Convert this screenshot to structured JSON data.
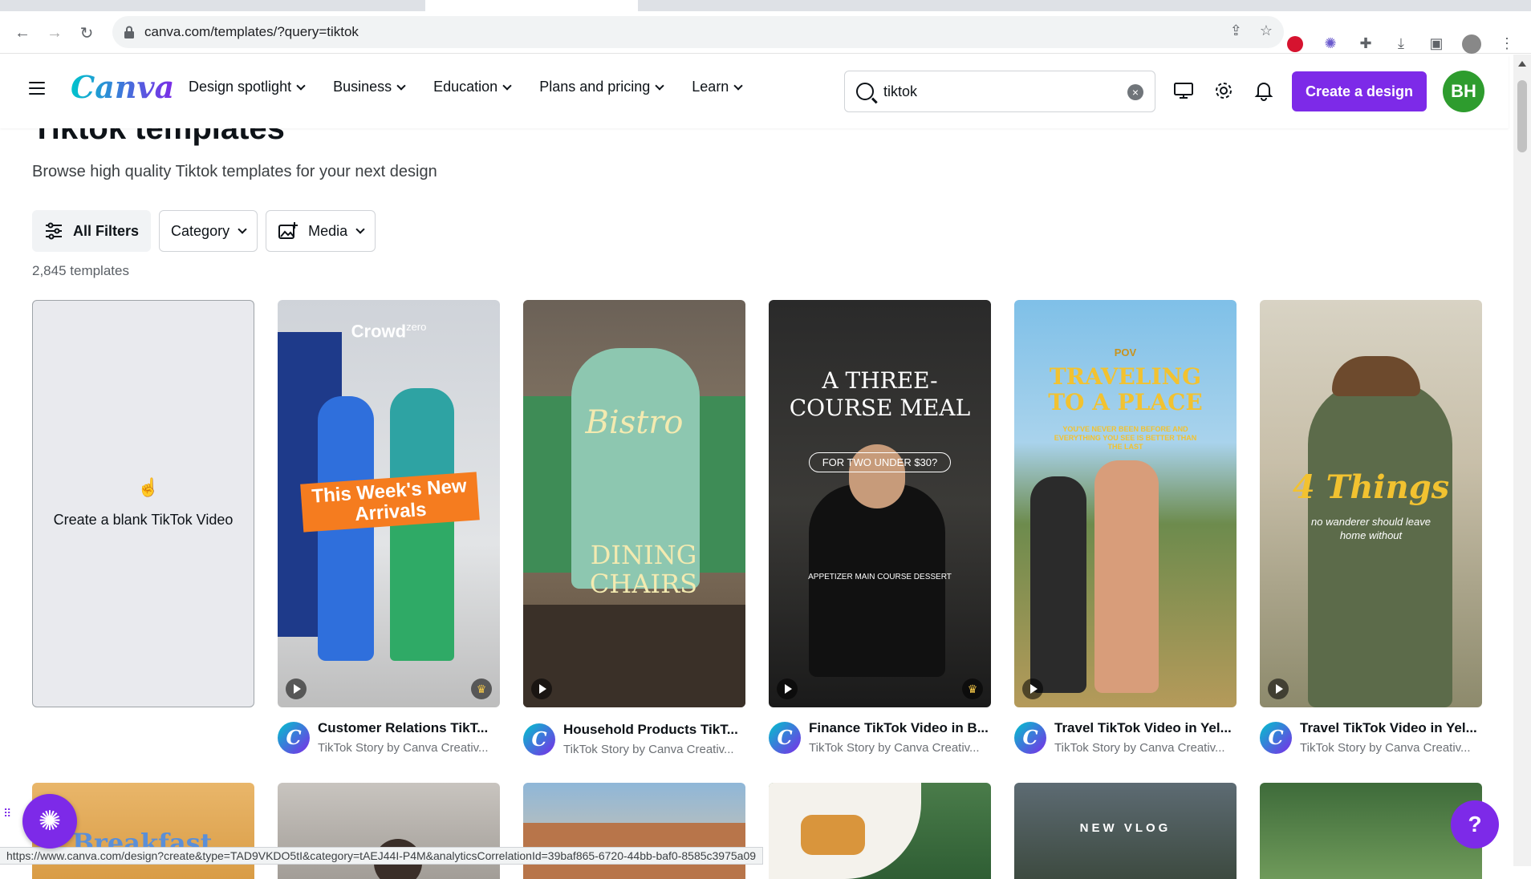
{
  "browser": {
    "url": "canva.com/templates/?query=tiktok",
    "status_url": "https://www.canva.com/design?create&type=TAD9VKDO5tI&category=tAEJ44I-P4M&analyticsCorrelationId=39baf865-6720-44bb-baf0-8585c3975a09"
  },
  "header": {
    "logo": "Canva",
    "nav": [
      {
        "label": "Design spotlight"
      },
      {
        "label": "Business"
      },
      {
        "label": "Education"
      },
      {
        "label": "Plans and pricing"
      },
      {
        "label": "Learn"
      }
    ],
    "search_value": "tiktok",
    "create_label": "Create a design",
    "avatar_initials": "BH",
    "accent_color": "#7d2ae8"
  },
  "page": {
    "title": "Tiktok templates",
    "subtitle": "Browse high quality Tiktok templates for your next design",
    "filters": {
      "all": "All Filters",
      "category": "Category",
      "media": "Media"
    },
    "count": "2,845 templates"
  },
  "blank_card": {
    "label": "Create a blank TikTok Video"
  },
  "templates": [
    {
      "title": "Customer Relations TikT...",
      "author": "TikTok Story by Canva Creativ...",
      "brand": "Crowd",
      "brand_sup": "zero",
      "headline": "This Week's New Arrivals",
      "premium": true
    },
    {
      "title": "Household Products TikT...",
      "author": "TikTok Story by Canva Creativ...",
      "brand": "Bistro",
      "headline": "DINING CHAIRS",
      "premium": false
    },
    {
      "title": "Finance TikTok Video in B...",
      "author": "TikTok Story by Canva Creativ...",
      "headline": "A THREE-COURSE MEAL",
      "tag": "FOR TWO UNDER $30?",
      "courses": "APPETIZER   MAIN COURSE   DESSERT",
      "premium": true
    },
    {
      "title": "Travel TikTok Video in Yel...",
      "author": "TikTok Story by Canva Creativ...",
      "pre": "POV",
      "headline": "TRAVELING TO A PLACE",
      "sub": "YOU'VE NEVER BEEN BEFORE AND EVERYTHING YOU SEE IS BETTER THAN THE LAST",
      "premium": false
    },
    {
      "title": "Travel TikTok Video in Yel...",
      "author": "TikTok Story by Canva Creativ...",
      "headline": "4 Things",
      "sub": "no wanderer should leave home without",
      "premium": false
    }
  ],
  "row2": {
    "card1_text": "Breakfast",
    "card5_text": "NEW VLOG"
  },
  "help_label": "?"
}
